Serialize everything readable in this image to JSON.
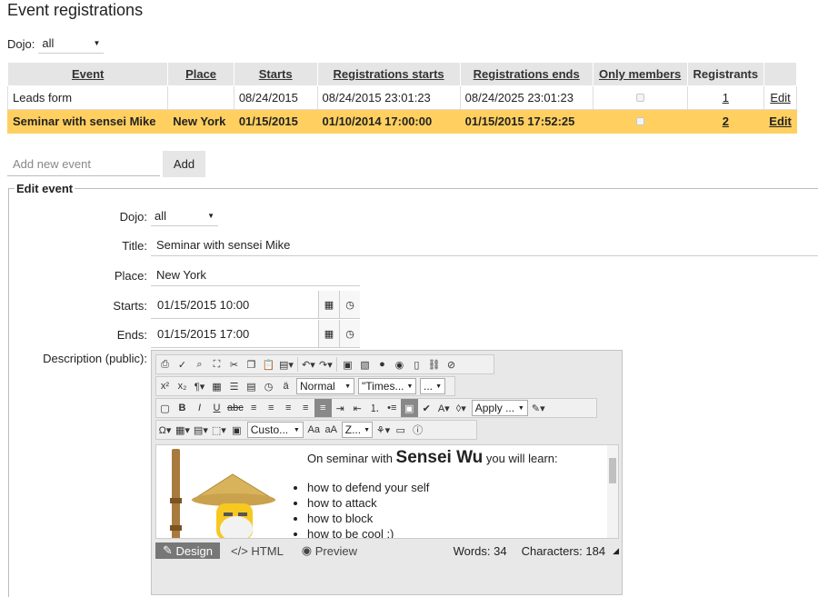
{
  "title": "Event registrations",
  "filter": {
    "label": "Dojo:",
    "value": "all"
  },
  "table": {
    "headers": [
      "Event",
      "Place",
      "Starts",
      "Registrations starts",
      "Registrations ends",
      "Only members",
      "Registrants",
      ""
    ],
    "rows": [
      {
        "event": "Leads form",
        "place": "",
        "starts": "08/24/2015",
        "reg_starts": "08/24/2015 23:01:23",
        "reg_ends": "08/24/2025 23:01:23",
        "registrants": "1",
        "action": "Edit",
        "selected": false
      },
      {
        "event": "Seminar with sensei Mike",
        "place": "New York",
        "starts": "01/15/2015",
        "reg_starts": "01/10/2014 17:00:00",
        "reg_ends": "01/15/2015 17:52:25",
        "registrants": "2",
        "action": "Edit",
        "selected": true
      }
    ]
  },
  "add_event": {
    "placeholder": "Add new event",
    "button": "Add"
  },
  "edit": {
    "legend": "Edit event",
    "dojo_label": "Dojo:",
    "dojo_value": "all",
    "title_label": "Title:",
    "title_value": "Seminar with sensei Mike",
    "place_label": "Place:",
    "place_value": "New York",
    "starts_label": "Starts:",
    "starts_value": "01/15/2015 10:00",
    "ends_label": "Ends:",
    "ends_value": "01/15/2015 17:00",
    "desc_label": "Description (public):"
  },
  "editor": {
    "dropdowns": {
      "format": "Normal",
      "font": "\"Times...",
      "size": "...",
      "apply": "Apply ...",
      "custom": "Custo...",
      "zoom": "Z..."
    },
    "content": {
      "lead_pre": "On seminar with ",
      "lead_name": "Sensei Wu",
      "lead_post": " you will learn:",
      "items": [
        "how to defend your self",
        "how to attack",
        "how to block",
        "how to be cool :)"
      ]
    },
    "modes": [
      "Design",
      "HTML",
      "Preview"
    ],
    "words": "Words: 34",
    "characters": "Characters: 184"
  }
}
